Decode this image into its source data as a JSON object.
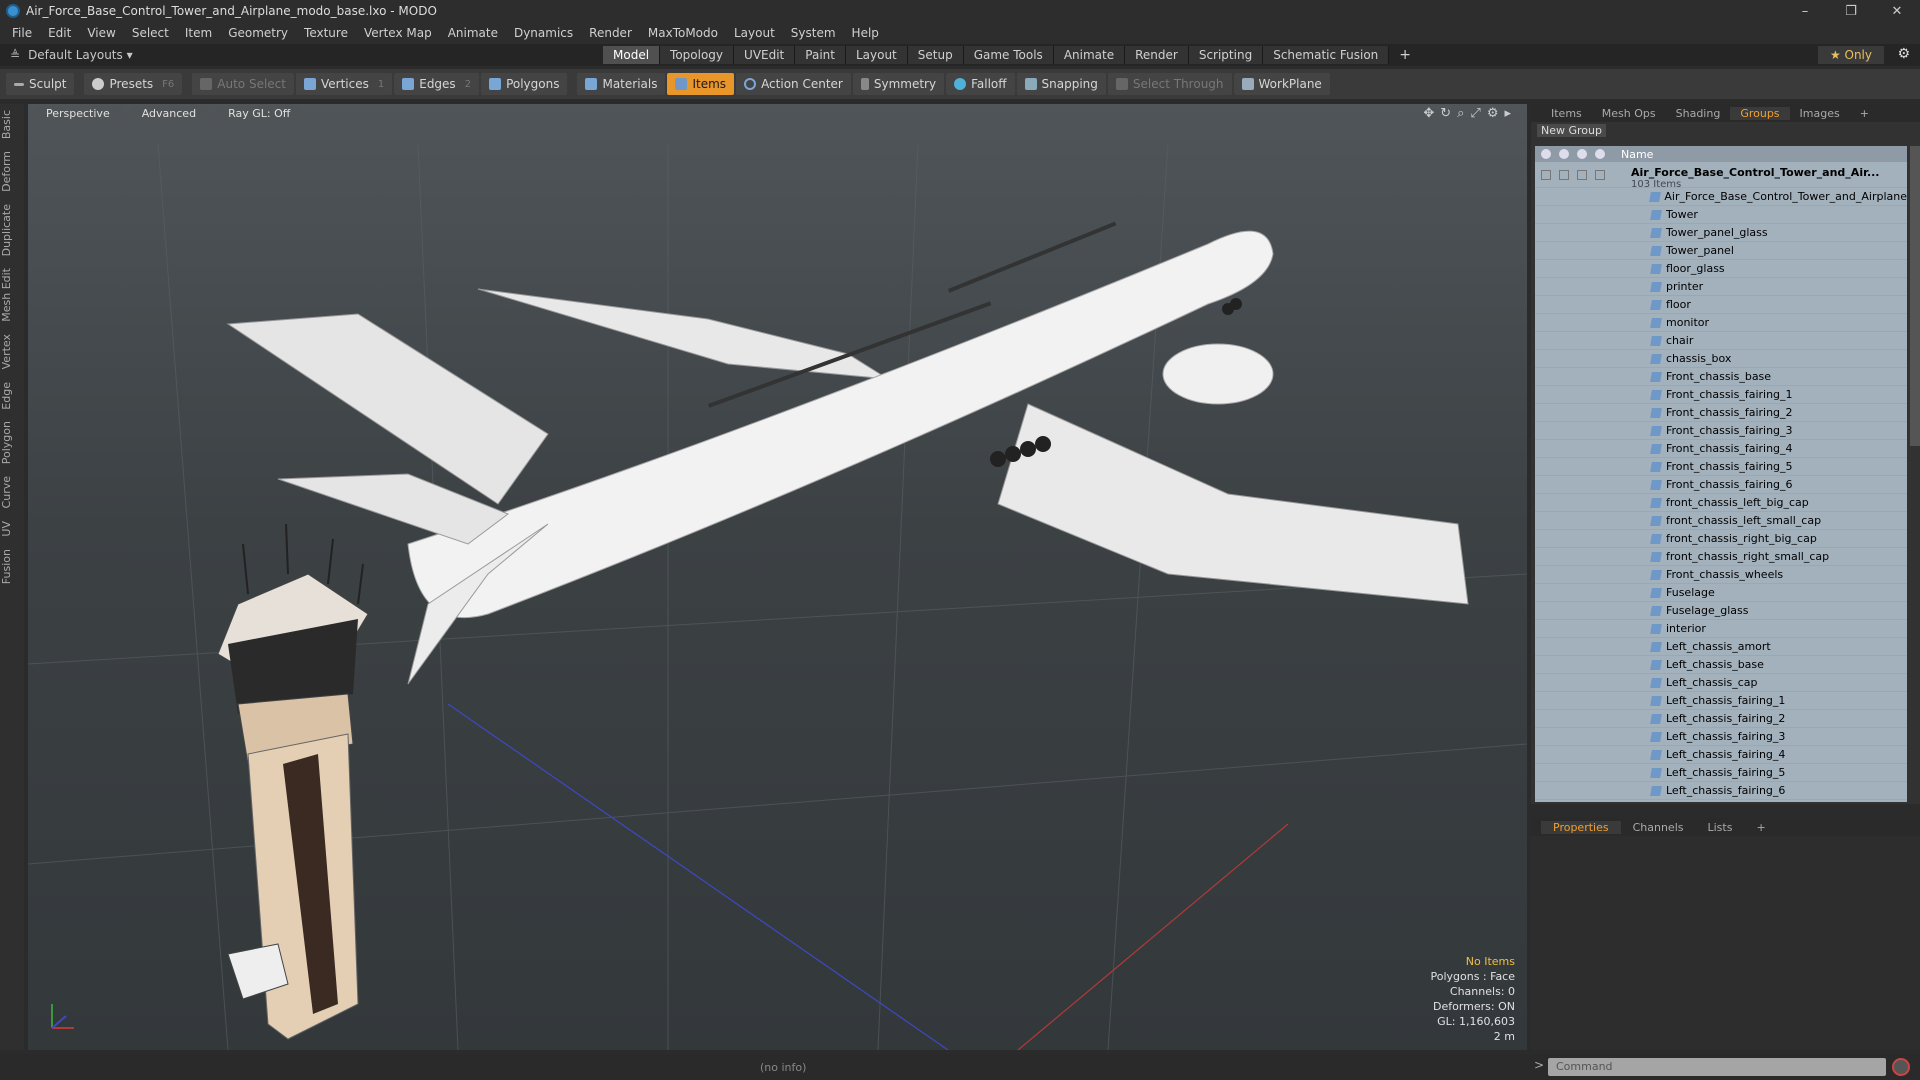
{
  "window": {
    "title": "Air_Force_Base_Control_Tower_and_Airplane_modo_base.lxo - MODO",
    "controls": [
      "–",
      "❐",
      "✕"
    ]
  },
  "menubar": [
    "File",
    "Edit",
    "View",
    "Select",
    "Item",
    "Geometry",
    "Texture",
    "Vertex Map",
    "Animate",
    "Dynamics",
    "Render",
    "MaxToModo",
    "Layout",
    "System",
    "Help"
  ],
  "layoutbar": {
    "layout_label": "Default Layouts ▾",
    "tabs": [
      "Model",
      "Topology",
      "UVEdit",
      "Paint",
      "Layout",
      "Setup",
      "Game Tools",
      "Animate",
      "Render",
      "Scripting",
      "Schematic Fusion",
      "+"
    ],
    "active_tab": "Model",
    "only_label": "★ Only"
  },
  "toolbar": {
    "sculpt": "Sculpt",
    "presets": "Presets",
    "presets_key": "F6",
    "auto_select": "Auto Select",
    "vertices": "Vertices",
    "vertices_key": "1",
    "edges": "Edges",
    "edges_key": "2",
    "polygons": "Polygons",
    "materials": "Materials",
    "items": "Items",
    "action_center": "Action Center",
    "symmetry": "Symmetry",
    "falloff": "Falloff",
    "snapping": "Snapping",
    "select_through": "Select Through",
    "workplane": "WorkPlane"
  },
  "left_tabs": [
    "Basic",
    "Deform",
    "Duplicate",
    "Mesh Edit",
    "Vertex",
    "Edge",
    "Polygon",
    "Curve",
    "UV",
    "Fusion"
  ],
  "viewport": {
    "view_mode": "Perspective",
    "shading": "Advanced",
    "raygl": "Ray GL: Off",
    "stats": {
      "items": "No Items",
      "polygons": "Polygons : Face",
      "channels": "Channels: 0",
      "deformers": "Deformers: ON",
      "gl": "GL: 1,160,603",
      "scale": "2 m"
    }
  },
  "right_panel": {
    "tabs": [
      "Items",
      "Mesh Ops",
      "Shading",
      "Groups",
      "Images",
      "+"
    ],
    "active_tab": "Groups",
    "new_group": "New Group",
    "name_header": "Name",
    "root_name": "Air_Force_Base_Control_Tower_and_Air...",
    "root_sub": "103 Items",
    "items": [
      "Air_Force_Base_Control_Tower_and_Airplane",
      "Tower",
      "Tower_panel_glass",
      "Tower_panel",
      "floor_glass",
      "printer",
      "floor",
      "monitor",
      "chair",
      "chassis_box",
      "Front_chassis_base",
      "Front_chassis_fairing_1",
      "Front_chassis_fairing_2",
      "Front_chassis_fairing_3",
      "Front_chassis_fairing_4",
      "Front_chassis_fairing_5",
      "Front_chassis_fairing_6",
      "front_chassis_left_big_cap",
      "front_chassis_left_small_cap",
      "front_chassis_right_big_cap",
      "front_chassis_right_small_cap",
      "Front_chassis_wheels",
      "Fuselage",
      "Fuselage_glass",
      "interior",
      "Left_chassis_amort",
      "Left_chassis_base",
      "Left_chassis_cap",
      "Left_chassis_fairing_1",
      "Left_chassis_fairing_2",
      "Left_chassis_fairing_3",
      "Left_chassis_fairing_4",
      "Left_chassis_fairing_5",
      "Left_chassis_fairing_6"
    ]
  },
  "props_panel": {
    "tabs": [
      "Properties",
      "Channels",
      "Lists",
      "+"
    ],
    "active_tab": "Properties"
  },
  "statusbar": {
    "info": "(no info)",
    "command_placeholder": "Command"
  }
}
